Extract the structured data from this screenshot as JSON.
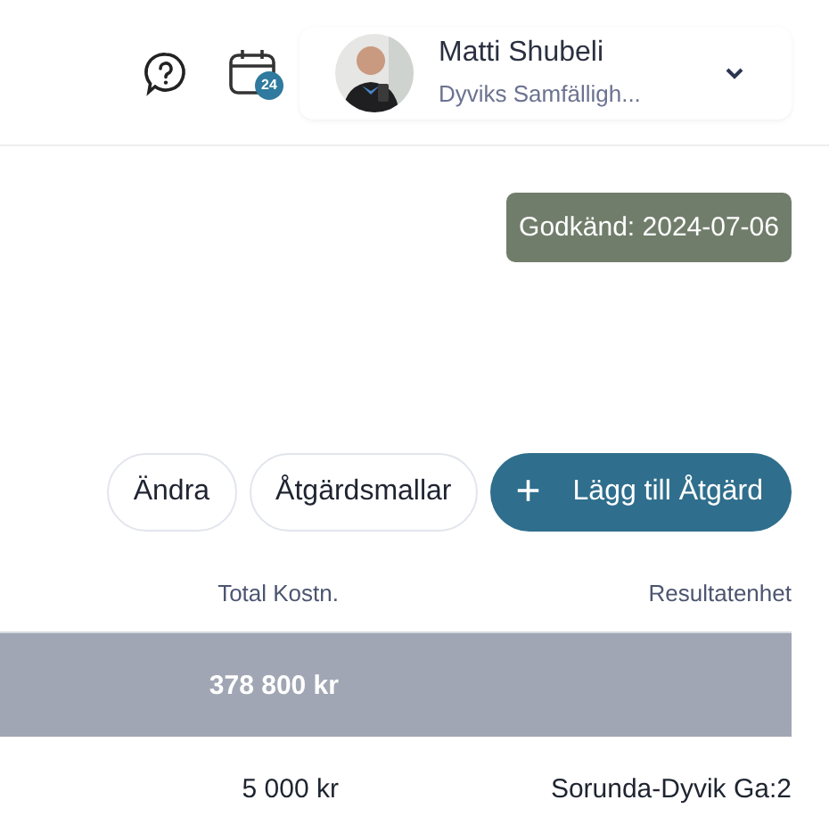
{
  "header": {
    "calendar_badge": "24",
    "user": {
      "name": "Matti Shubeli",
      "organization": "Dyviks Samfälligh..."
    }
  },
  "status_badge": "Godkänd: 2024-07-06",
  "actions": [
    {
      "label": "Ändra",
      "kind": "outline"
    },
    {
      "label": "Åtgärdsmallar",
      "kind": "outline"
    },
    {
      "label": "Lägg till Åtgärd",
      "kind": "primary",
      "icon": "+"
    }
  ],
  "table": {
    "columns": [
      "Total Kostn.",
      "Resultatenhet"
    ],
    "rows": [
      {
        "kind": "group",
        "total_cost": "378 800 kr"
      },
      {
        "kind": "item",
        "total_cost": "5 000 kr",
        "result_unit": "Sorunda-Dyvik Ga:2"
      }
    ]
  }
}
